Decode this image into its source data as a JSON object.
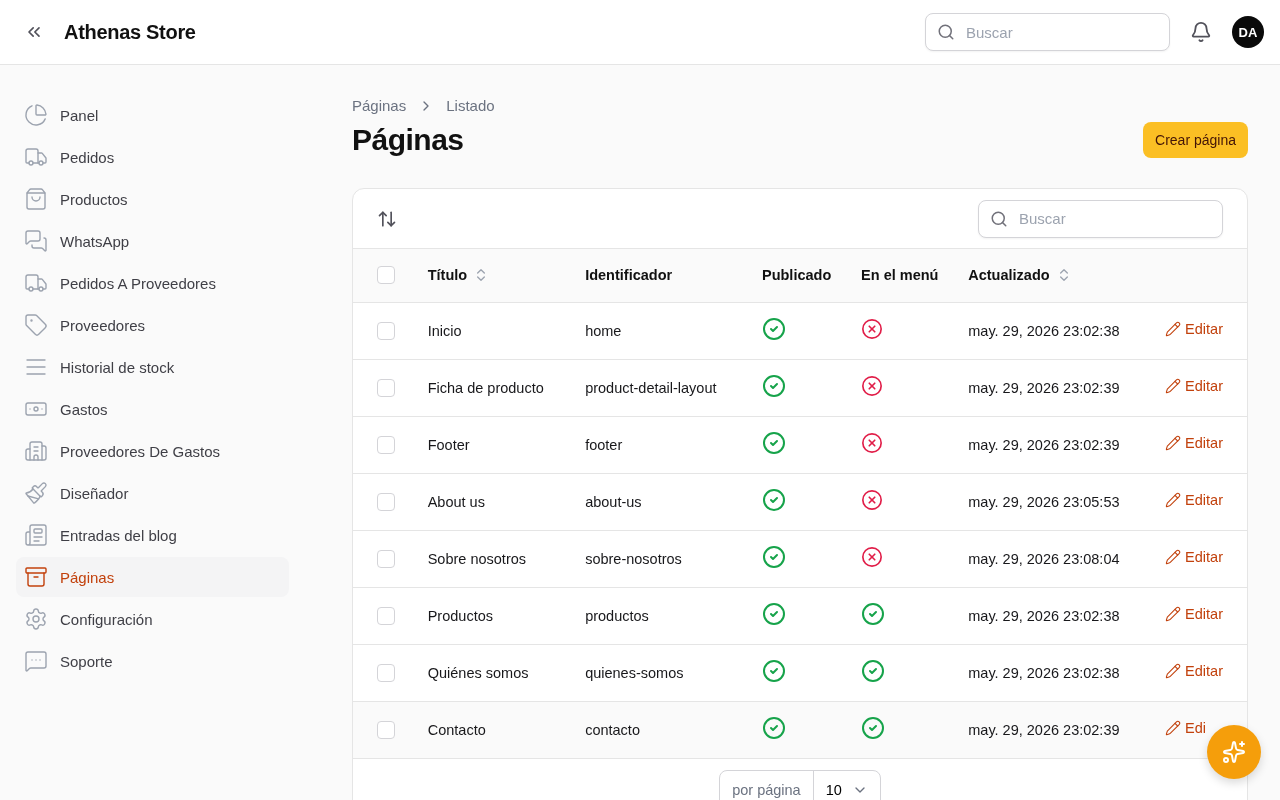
{
  "header": {
    "title": "Athenas Store",
    "search": {
      "placeholder": "Buscar"
    },
    "avatar": "DA"
  },
  "sidebar": {
    "items": [
      {
        "label": "Panel",
        "selected": false
      },
      {
        "label": "Pedidos",
        "selected": false
      },
      {
        "label": "Productos",
        "selected": false
      },
      {
        "label": "WhatsApp",
        "selected": false
      },
      {
        "label": "Pedidos A Proveedores",
        "selected": false
      },
      {
        "label": "Proveedores",
        "selected": false
      },
      {
        "label": "Historial de stock",
        "selected": false
      },
      {
        "label": "Gastos",
        "selected": false
      },
      {
        "label": "Proveedores De Gastos",
        "selected": false
      },
      {
        "label": "Diseñador",
        "selected": false
      },
      {
        "label": "Entradas del blog",
        "selected": false
      },
      {
        "label": "Páginas",
        "selected": true
      },
      {
        "label": "Configuración",
        "selected": false
      },
      {
        "label": "Soporte",
        "selected": false
      }
    ]
  },
  "breadcrumb": [
    "Páginas",
    "Listado"
  ],
  "page_title": "Páginas",
  "create_button": "Crear página",
  "table": {
    "search": {
      "placeholder": "Buscar"
    },
    "select_all": {
      "checked": false
    },
    "columns": [
      {
        "label": "Título",
        "sortable": true
      },
      {
        "label": "Identificador",
        "sortable": false
      },
      {
        "label": "Publicado",
        "sortable": false
      },
      {
        "label": "En el menú",
        "sortable": false
      },
      {
        "label": "Actualizado",
        "sortable": true
      }
    ],
    "rows": [
      {
        "checked": false,
        "title": "Inicio",
        "slug": "home",
        "published": true,
        "in_menu": false,
        "updated": "may. 29, 2026 23:02:38",
        "action": "Editar",
        "hovered": false
      },
      {
        "checked": false,
        "title": "Ficha de producto",
        "slug": "product-detail-layout",
        "published": true,
        "in_menu": false,
        "updated": "may. 29, 2026 23:02:39",
        "action": "Editar",
        "hovered": false
      },
      {
        "checked": false,
        "title": "Footer",
        "slug": "footer",
        "published": true,
        "in_menu": false,
        "updated": "may. 29, 2026 23:02:39",
        "action": "Editar",
        "hovered": false
      },
      {
        "checked": false,
        "title": "About us",
        "slug": "about-us",
        "published": true,
        "in_menu": false,
        "updated": "may. 29, 2026 23:05:53",
        "action": "Editar",
        "hovered": false
      },
      {
        "checked": false,
        "title": "Sobre nosotros",
        "slug": "sobre-nosotros",
        "published": true,
        "in_menu": false,
        "updated": "may. 29, 2026 23:08:04",
        "action": "Editar",
        "hovered": false
      },
      {
        "checked": false,
        "title": "Productos",
        "slug": "productos",
        "published": true,
        "in_menu": true,
        "updated": "may. 29, 2026 23:02:38",
        "action": "Editar",
        "hovered": false
      },
      {
        "checked": false,
        "title": "Quiénes somos",
        "slug": "quienes-somos",
        "published": true,
        "in_menu": true,
        "updated": "may. 29, 2026 23:02:38",
        "action": "Editar",
        "hovered": false
      },
      {
        "checked": false,
        "title": "Contacto",
        "slug": "contacto",
        "published": true,
        "in_menu": true,
        "updated": "may. 29, 2026 23:02:39",
        "action": "Edi",
        "hovered": true
      }
    ],
    "pagination": {
      "label": "por página",
      "per_page": "10"
    }
  }
}
